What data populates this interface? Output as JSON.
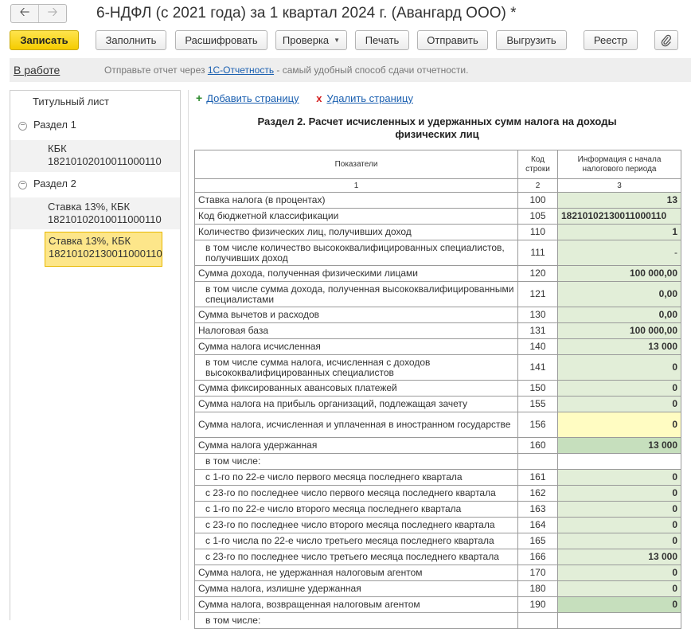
{
  "window": {
    "title": "6-НДФЛ (с 2021 года) за 1 квартал 2024 г. (Авангард ООО) *",
    "back_icon": "arrow-left-icon",
    "forward_icon": "arrow-right-icon"
  },
  "toolbar": {
    "save": "Записать",
    "fill": "Заполнить",
    "decode": "Расшифровать",
    "check": "Проверка",
    "print": "Печать",
    "send": "Отправить",
    "export": "Выгрузить",
    "registry": "Реестр",
    "attach_icon": "paperclip-icon"
  },
  "status": {
    "state": "В работе",
    "message_before": "Отправьте отчет через ",
    "message_link": "1С-Отчетность",
    "message_after": " - самый удобный способ сдачи отчетности."
  },
  "tree": {
    "title_page": "Титульный лист",
    "section1": "Раздел 1",
    "section1_child_line1": "КБК",
    "section1_child_line2": "18210102010011000110",
    "section2": "Раздел 2",
    "section2_child1_line1": "Ставка 13%, КБК",
    "section2_child1_line2": "18210102010011000110",
    "section2_child2_line1": "Ставка 13%, КБК",
    "section2_child2_line2": "18210102130011000110"
  },
  "page_actions": {
    "add_page": "Добавить страницу",
    "delete_page": "Удалить страницу",
    "add_icon_glyph": "+",
    "delete_icon_glyph": "x"
  },
  "section": {
    "title_line1": "Раздел 2. Расчет исчисленных и удержанных сумм налога на доходы",
    "title_line2": "физических лиц"
  },
  "table": {
    "headers": {
      "indicator": "Показатели",
      "code_line1": "Код",
      "code_line2": "строки",
      "info_line1": "Информация с начала",
      "info_line2": "налогового периода"
    },
    "column_numbers": [
      "1",
      "2",
      "3"
    ],
    "rows": [
      {
        "label": "Ставка налога (в процентах)",
        "code": "100",
        "value": "13"
      },
      {
        "label": "Код бюджетной классификации",
        "code": "105",
        "value": "18210102130011000110"
      },
      {
        "label": "Количество физических лиц, получивших доход",
        "code": "110",
        "value": "1"
      },
      {
        "label": "в том числе количество высококвалифицированных специалистов, получивших доход",
        "code": "111",
        "value": "-"
      },
      {
        "label": "Сумма дохода, полученная физическими лицами",
        "code": "120",
        "value": "100 000,00"
      },
      {
        "label": "в том числе сумма дохода, полученная высококвалифицированными специалистами",
        "code": "121",
        "value": "0,00"
      },
      {
        "label": "Сумма вычетов и расходов",
        "code": "130",
        "value": "0,00"
      },
      {
        "label": "Налоговая база",
        "code": "131",
        "value": "100 000,00"
      },
      {
        "label": "Сумма налога исчисленная",
        "code": "140",
        "value": "13 000"
      },
      {
        "label": "в том числе сумма налога, исчисленная с доходов высококвалифицированных специалистов",
        "code": "141",
        "value": "0"
      },
      {
        "label": "Сумма фиксированных авансовых платежей",
        "code": "150",
        "value": "0"
      },
      {
        "label": "Сумма налога на прибыль организаций, подлежащая зачету",
        "code": "155",
        "value": "0"
      },
      {
        "label": "Сумма налога, исчисленная и уплаченная в иностранном государстве",
        "code": "156",
        "value": "0"
      },
      {
        "label": "Сумма налога удержанная",
        "code": "160",
        "value": "13 000"
      },
      {
        "label": "в том числе:",
        "code": "",
        "value": ""
      },
      {
        "label": "с 1-го по 22-е число первого месяца последнего квартала",
        "code": "161",
        "value": "0"
      },
      {
        "label": "с 23-го по последнее число первого месяца последнего квартала",
        "code": "162",
        "value": "0"
      },
      {
        "label": "с 1-го по 22-е число второго месяца последнего квартала",
        "code": "163",
        "value": "0"
      },
      {
        "label": "с 23-го по последнее число второго месяца последнего квартала",
        "code": "164",
        "value": "0"
      },
      {
        "label": "с 1-го числа по 22-е число третьего месяца последнего квартала",
        "code": "165",
        "value": "0"
      },
      {
        "label": "с 23-го по последнее число третьего месяца последнего квартала",
        "code": "166",
        "value": "13 000"
      },
      {
        "label": "Сумма налога, не удержанная налоговым агентом",
        "code": "170",
        "value": "0"
      },
      {
        "label": "Сумма налога, излишне удержанная",
        "code": "180",
        "value": "0"
      },
      {
        "label": "Сумма налога, возвращенная налоговым агентом",
        "code": "190",
        "value": "0"
      },
      {
        "label": "в том числе:",
        "code": "",
        "value": ""
      }
    ]
  }
}
